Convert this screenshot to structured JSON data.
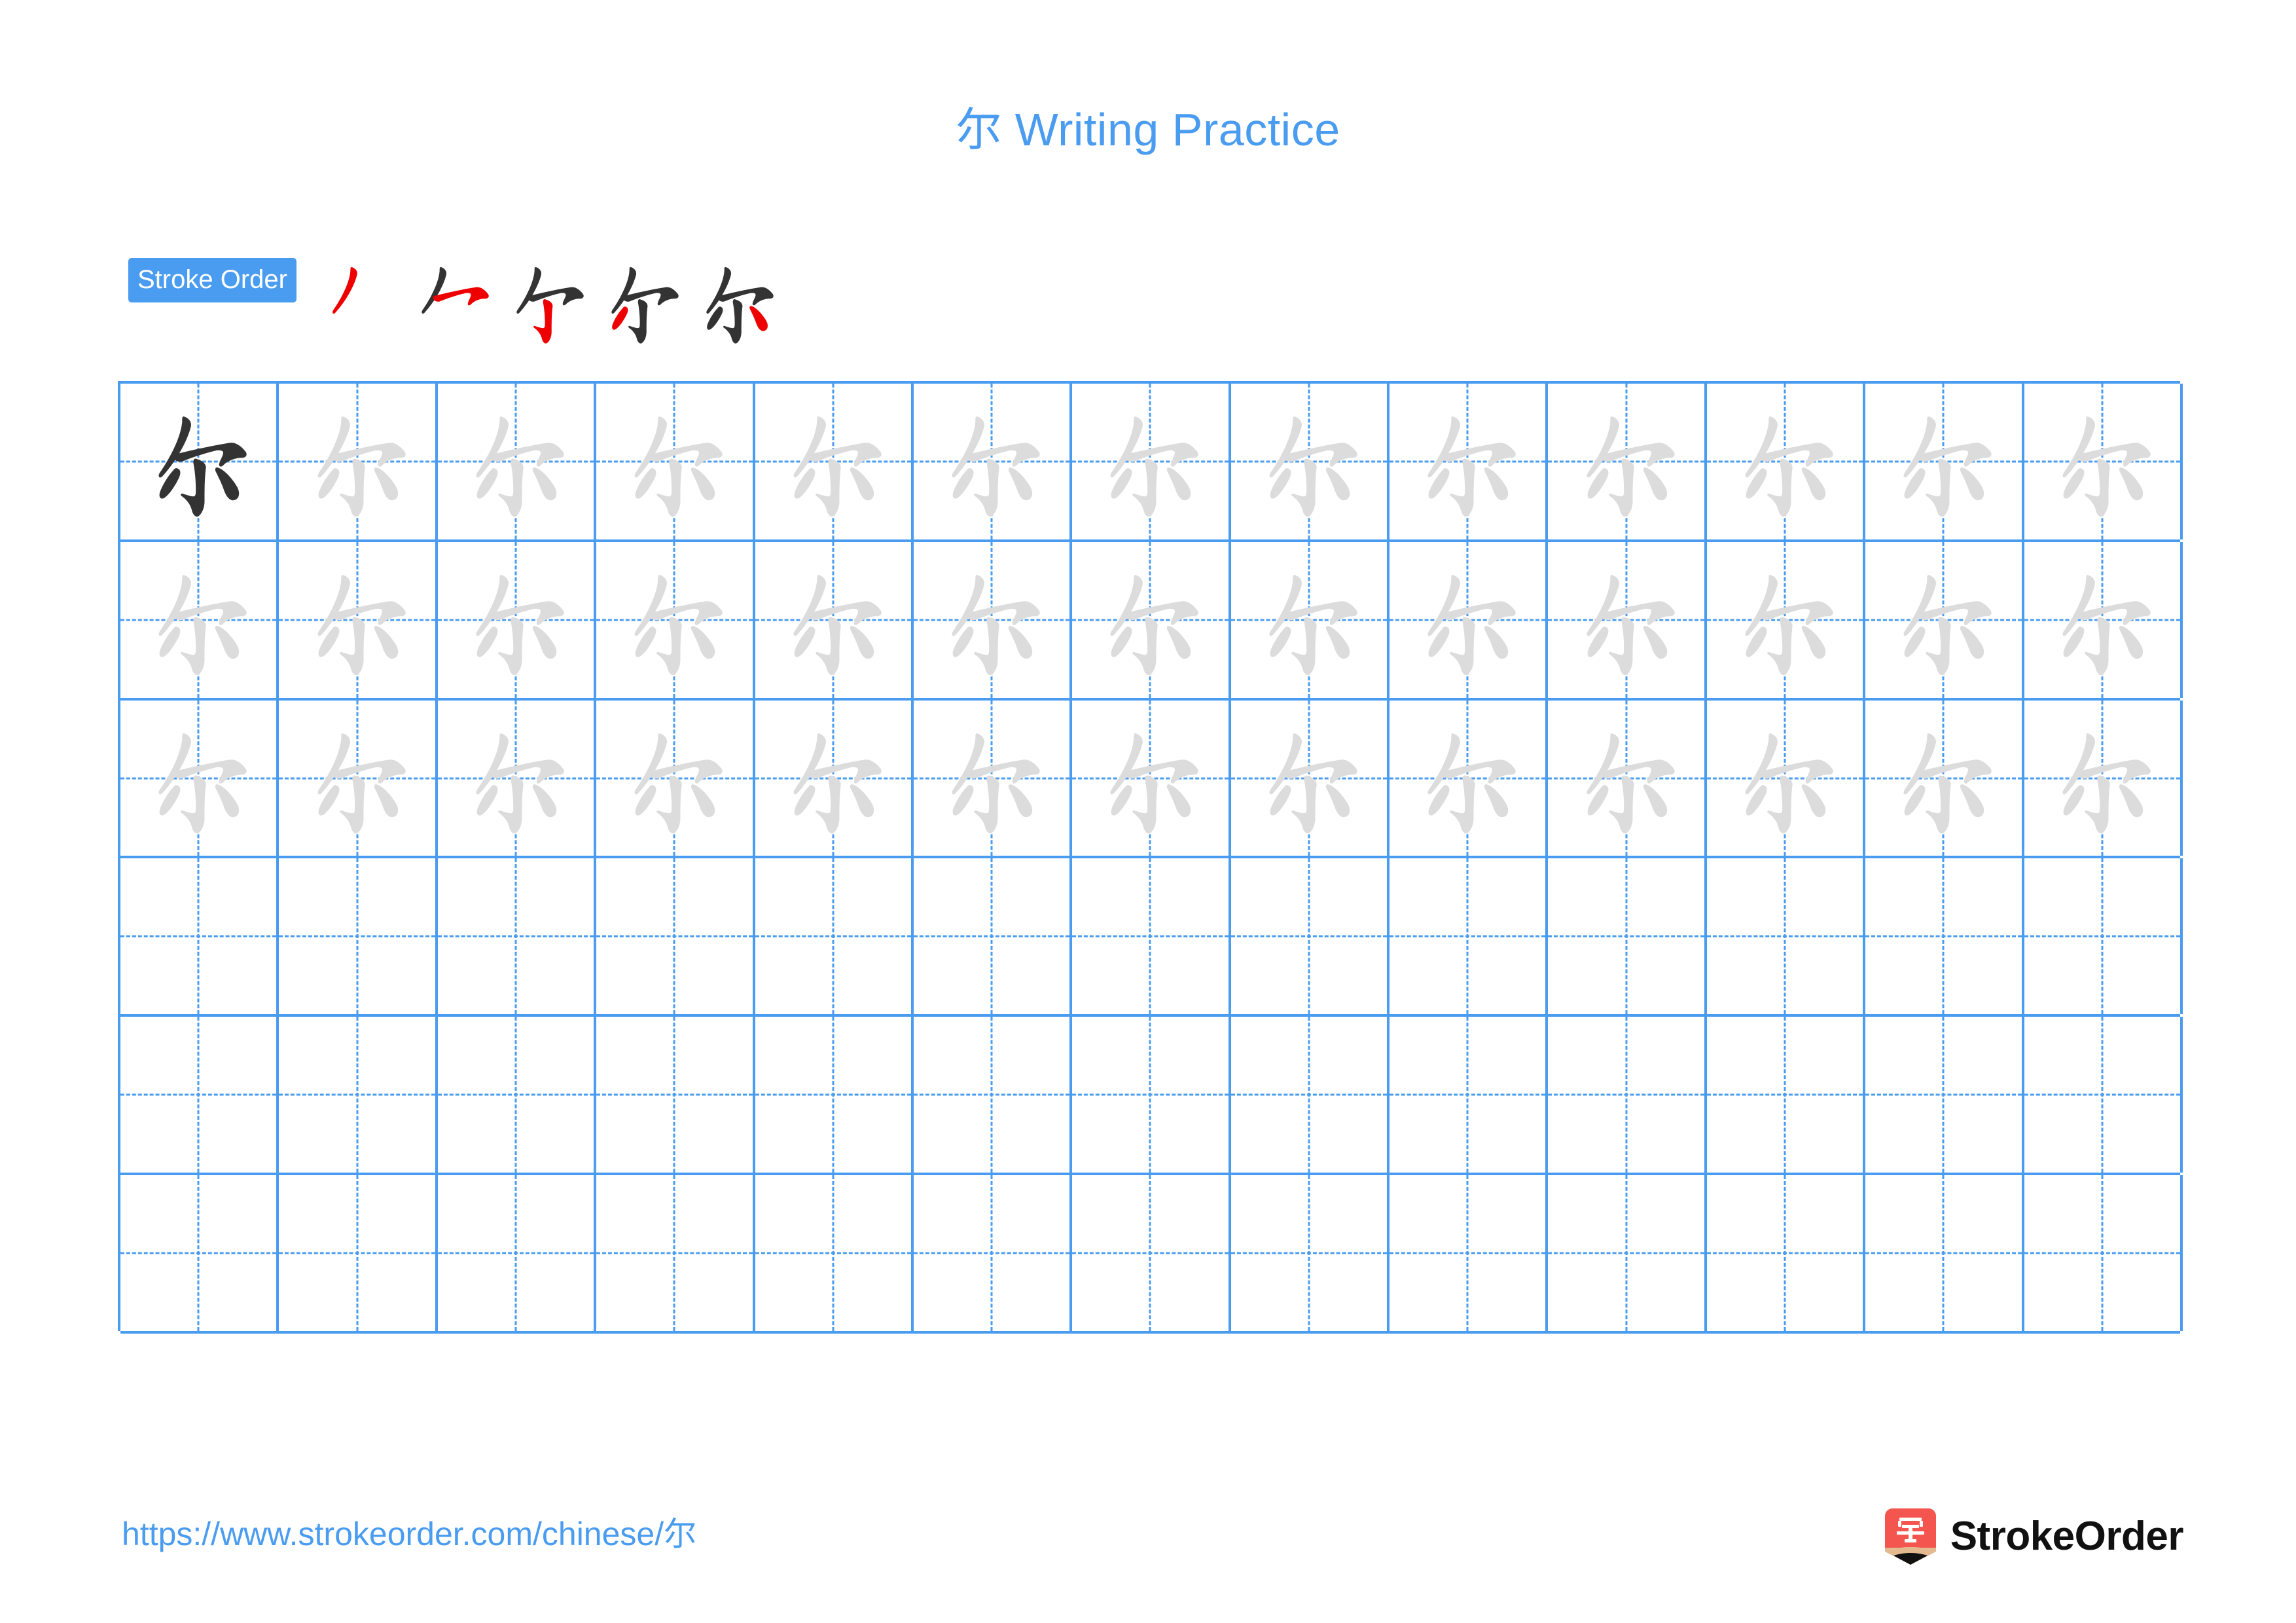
{
  "page": {
    "title": "尔 Writing Practice",
    "character": "尔",
    "accent_color": "#4a9cf0",
    "trace_color": "#dcdcdc",
    "ink_color": "#333333",
    "highlight_color": "#ee0000"
  },
  "stroke_order": {
    "label": "Stroke Order",
    "stroke_count": 5,
    "steps": [
      {
        "index": 1,
        "new_stroke": "piě",
        "cumulative": "丿"
      },
      {
        "index": 2,
        "new_stroke": "héng-gōu",
        "cumulative": "⺈"
      },
      {
        "index": 3,
        "new_stroke": "shù-gōu",
        "cumulative": "亇"
      },
      {
        "index": 4,
        "new_stroke": "piě-diǎn",
        "cumulative": "尓"
      },
      {
        "index": 5,
        "new_stroke": "diǎn",
        "cumulative": "尔"
      }
    ]
  },
  "grid": {
    "columns": 13,
    "rows": 6,
    "cell_states": [
      [
        "ink",
        "trace",
        "trace",
        "trace",
        "trace",
        "trace",
        "trace",
        "trace",
        "trace",
        "trace",
        "trace",
        "trace",
        "trace"
      ],
      [
        "trace",
        "trace",
        "trace",
        "trace",
        "trace",
        "trace",
        "trace",
        "trace",
        "trace",
        "trace",
        "trace",
        "trace",
        "trace"
      ],
      [
        "trace",
        "trace",
        "trace",
        "trace",
        "trace",
        "trace",
        "trace",
        "trace",
        "trace",
        "trace",
        "trace",
        "trace",
        "trace"
      ],
      [
        "empty",
        "empty",
        "empty",
        "empty",
        "empty",
        "empty",
        "empty",
        "empty",
        "empty",
        "empty",
        "empty",
        "empty",
        "empty"
      ],
      [
        "empty",
        "empty",
        "empty",
        "empty",
        "empty",
        "empty",
        "empty",
        "empty",
        "empty",
        "empty",
        "empty",
        "empty",
        "empty"
      ],
      [
        "empty",
        "empty",
        "empty",
        "empty",
        "empty",
        "empty",
        "empty",
        "empty",
        "empty",
        "empty",
        "empty",
        "empty",
        "empty"
      ]
    ]
  },
  "footer": {
    "url": "https://www.strokeorder.com/chinese/尔",
    "brand_name": "StrokeOrder",
    "logo_character": "字"
  }
}
